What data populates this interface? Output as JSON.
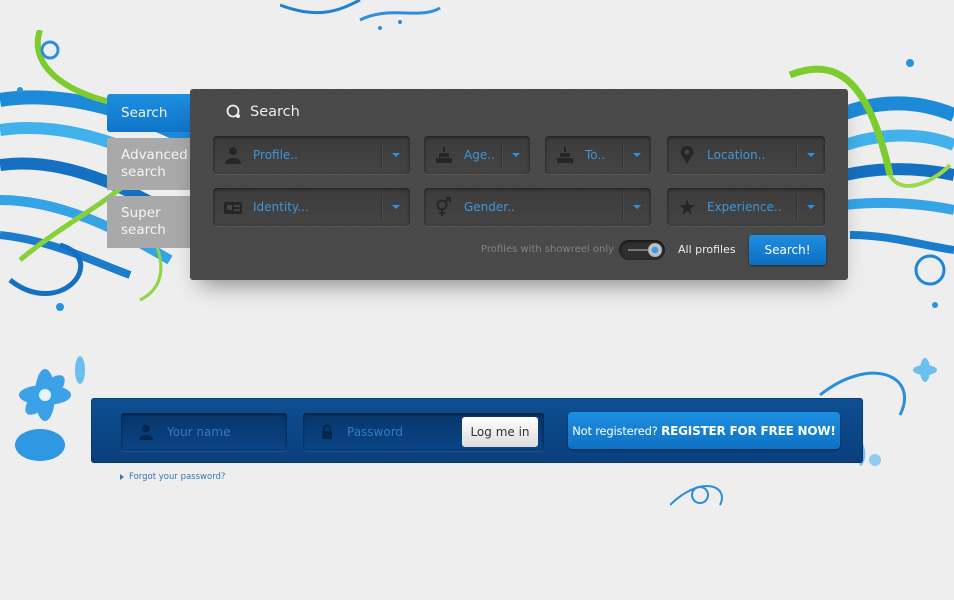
{
  "sidebar": {
    "tabs": [
      {
        "label": "Search",
        "active": true
      },
      {
        "label": "Advanced search",
        "active": false
      },
      {
        "label": "Super search",
        "active": false
      }
    ]
  },
  "search_panel": {
    "title": "Search",
    "title_icon": "search-icon",
    "dropdowns": [
      {
        "label": "Profile..",
        "icon": "person-icon"
      },
      {
        "label": "Age..",
        "icon": "cake-icon"
      },
      {
        "label": "To..",
        "icon": "cake-icon"
      },
      {
        "label": "Location..",
        "icon": "location-pin-icon"
      },
      {
        "label": "Identity...",
        "icon": "id-card-icon"
      },
      {
        "label": "Gender..",
        "icon": "gender-icon"
      },
      {
        "label": "Experience..",
        "icon": "star-icon"
      }
    ],
    "toggle": {
      "left_label": "Profiles with showreel only",
      "right_label": "All profiles",
      "state": "All profiles"
    },
    "submit_label": "Search!"
  },
  "login": {
    "username_placeholder": "Your name",
    "password_placeholder": "Password",
    "login_label": "Log me in",
    "register_prefix": "Not registered?",
    "register_cta": "REGISTER FOR FREE NOW!",
    "forgot_label": "Forgot your password?"
  },
  "colors": {
    "accent": "#1582d6",
    "panel": "#484848",
    "login_bar": "#0c4a8c",
    "background": "#eeeeee"
  }
}
